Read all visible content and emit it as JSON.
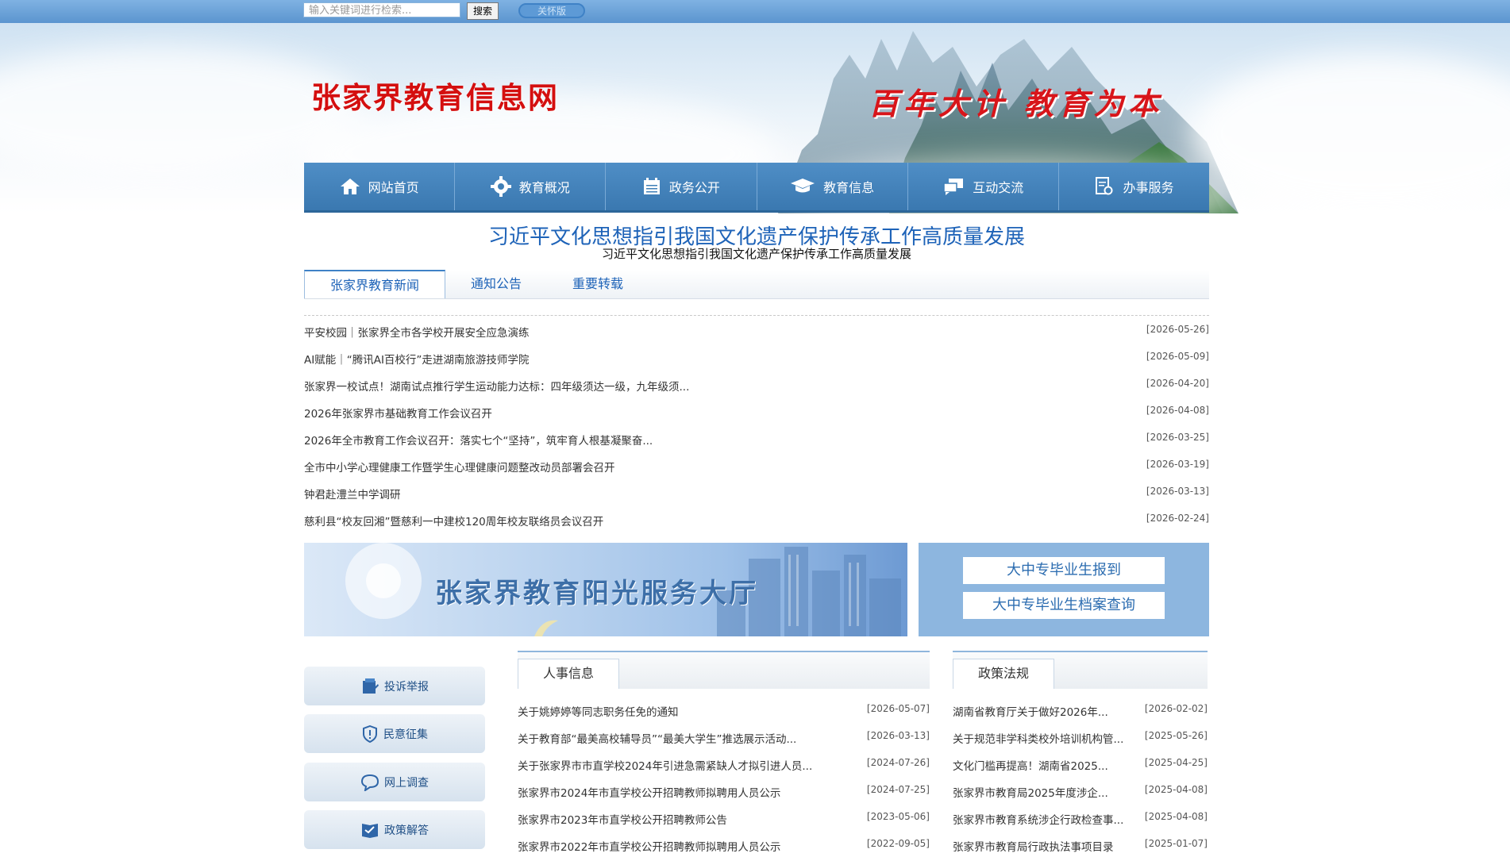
{
  "topbar": {
    "search_placeholder": "输入关键词进行检索...",
    "search_button": "搜索",
    "care_button": "关怀版"
  },
  "banner": {
    "site_title": "张家界教育信息网",
    "slogan": "百年大计  教育为本"
  },
  "nav": {
    "items": [
      {
        "label": "网站首页",
        "icon": "home-icon"
      },
      {
        "label": "教育概况",
        "icon": "gear-icon"
      },
      {
        "label": "政务公开",
        "icon": "calendar-icon"
      },
      {
        "label": "教育信息",
        "icon": "graduation-cap-icon"
      },
      {
        "label": "互动交流",
        "icon": "chat-icon"
      },
      {
        "label": "办事服务",
        "icon": "document-search-icon"
      }
    ]
  },
  "headline": {
    "title": "习近平文化思想指引我国文化遗产保护传承工作高质量发展",
    "subtitle": "习近平文化思想指引我国文化遗产保护传承工作高质量发展"
  },
  "tabs": [
    "张家界教育新闻",
    "通知公告",
    "重要转载"
  ],
  "news": [
    {
      "title": "平安校园｜张家界全市各学校开展安全应急演练",
      "date": "[2026-05-26]"
    },
    {
      "title": "AI赋能｜“腾讯AI百校行”走进湖南旅游技师学院",
      "date": "[2026-05-09]"
    },
    {
      "title": "张家界一校试点！湖南试点推行学生运动能力达标：四年级须达一级，九年级须...",
      "date": "[2026-04-20]"
    },
    {
      "title": "2026年张家界市基础教育工作会议召开",
      "date": "[2026-04-08]"
    },
    {
      "title": "2026年全市教育工作会议召开：落实七个“坚持”，筑牢育人根基凝聚奋...",
      "date": "[2026-03-25]"
    },
    {
      "title": "全市中小学心理健康工作暨学生心理健康问题整改动员部署会召开",
      "date": "[2026-03-19]"
    },
    {
      "title": "钟君赴澧兰中学调研",
      "date": "[2026-03-13]"
    },
    {
      "title": "慈利县“校友回湘”暨慈利一中建校120周年校友联络员会议召开",
      "date": "[2026-02-24]"
    }
  ],
  "service": {
    "banner_title": "张家界教育阳光服务大厅",
    "buttons": [
      "大中专毕业生报到",
      "大中专毕业生档案查询"
    ]
  },
  "side_buttons": [
    {
      "label": "投诉举报",
      "icon": "report-icon"
    },
    {
      "label": "民意征集",
      "icon": "shield-icon"
    },
    {
      "label": "网上调查",
      "icon": "chat-bubble-icon"
    },
    {
      "label": "政策解答",
      "icon": "book-icon"
    }
  ],
  "personnel": {
    "heading": "人事信息",
    "items": [
      {
        "title": "关于姚婷婷等同志职务任免的通知",
        "date": "[2026-05-07]"
      },
      {
        "title": "关于教育部“最美高校辅导员”“最美大学生”推选展示活动...",
        "date": "[2026-03-13]"
      },
      {
        "title": "关于张家界市市直学校2024年引进急需紧缺人才拟引进人员...",
        "date": "[2024-07-26]"
      },
      {
        "title": "张家界市2024年市直学校公开招聘教师拟聘用人员公示",
        "date": "[2024-07-25]"
      },
      {
        "title": "张家界市2023年市直学校公开招聘教师公告",
        "date": "[2023-05-06]"
      },
      {
        "title": "张家界市2022年市直学校公开招聘教师拟聘用人员公示",
        "date": "[2022-09-05]"
      }
    ]
  },
  "policy": {
    "heading": "政策法规",
    "items": [
      {
        "title": "湖南省教育厅关于做好2026年...",
        "date": "[2026-02-02]"
      },
      {
        "title": "关于规范非学科类校外培训机构管...",
        "date": "[2025-05-26]"
      },
      {
        "title": "文化门槛再提高！湖南省2025...",
        "date": "[2025-04-25]"
      },
      {
        "title": "张家界市教育局2025年度涉企...",
        "date": "[2025-04-08]"
      },
      {
        "title": "张家界市教育系统涉企行政检查事...",
        "date": "[2025-04-08]"
      },
      {
        "title": "张家界市教育局行政执法事项目录",
        "date": "[2025-01-07]"
      }
    ]
  },
  "colors": {
    "topbar": "#5b95cf",
    "nav": "#3a78b0",
    "title_red": "#d40f0f",
    "link_blue": "#1e63b8"
  }
}
